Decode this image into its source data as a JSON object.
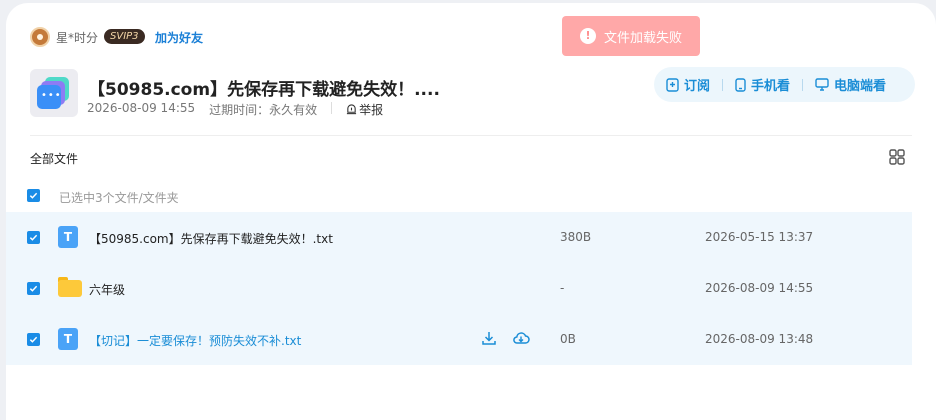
{
  "owner": {
    "name": "星*时分",
    "vip_badge": "SVIP3",
    "add_friend": "加为好友"
  },
  "toast": {
    "text": "文件加载失败",
    "icon": "alert-circle-icon"
  },
  "share": {
    "title": "【50985.com】先保存再下载避免失效！....",
    "date": "2026-08-09 14:55",
    "expire": "过期时间：永久有效",
    "report": "举报"
  },
  "views": [
    {
      "label": "订阅",
      "icon": "bookmark-icon"
    },
    {
      "label": "手机看",
      "icon": "phone-icon"
    },
    {
      "label": "电脑端看",
      "icon": "monitor-icon"
    }
  ],
  "file_list": {
    "breadcrumb": "全部文件",
    "selected_text": "已选中3个文件/文件夹",
    "rows": [
      {
        "name": "【50985.com】先保存再下载避免失效！.txt",
        "size": "380B",
        "date": "2026-05-15 13:37",
        "type": "txt-file-icon"
      },
      {
        "name": "六年级",
        "size": "-",
        "date": "2026-08-09 14:55",
        "type": "folder-icon"
      },
      {
        "name": "【切记】一定要保存！预防失效不补.txt",
        "size": "0B",
        "date": "2026-08-09 13:48",
        "type": "txt-file-icon"
      }
    ]
  },
  "colors": {
    "accent": "#1a8dd6",
    "toast_bg": "#ffa8a8",
    "row_bg": "#eff7fd"
  }
}
